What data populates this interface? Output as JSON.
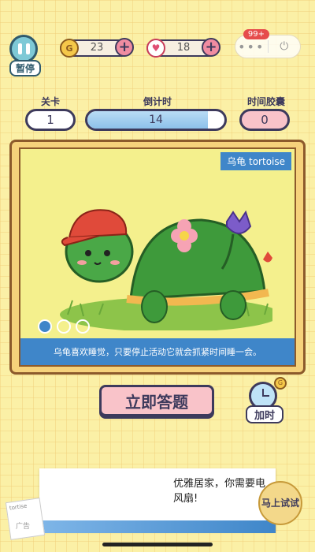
{
  "header": {
    "pause_label": "暂停",
    "coins": "23",
    "hearts": "18",
    "menu_dots": "•••",
    "notification_badge": "99+"
  },
  "stats": {
    "level_label": "关卡",
    "level_value": "1",
    "countdown_label": "倒计时",
    "countdown_value": "14",
    "countdown_progress": 0.88,
    "capsule_label": "时间胶囊",
    "capsule_value": "0"
  },
  "card": {
    "name_tag": "乌龟 tortoise",
    "description": "乌龟喜欢睡觉，只要停止活动它就会抓紧时间睡一会。",
    "pagination_count": 3,
    "pagination_active": 0
  },
  "actions": {
    "answer_label": "立即答题",
    "add_time_label": "加时"
  },
  "ad": {
    "text": "优雅居家，你需要电风扇!",
    "cta_label": "马上试试",
    "corner_label": "广告",
    "corner_text": "tortise"
  },
  "colors": {
    "background": "#fbf0a6",
    "accent_blue": "#3f86c9",
    "outline": "#3d3a5c",
    "pink_button": "#f9c3c9"
  }
}
